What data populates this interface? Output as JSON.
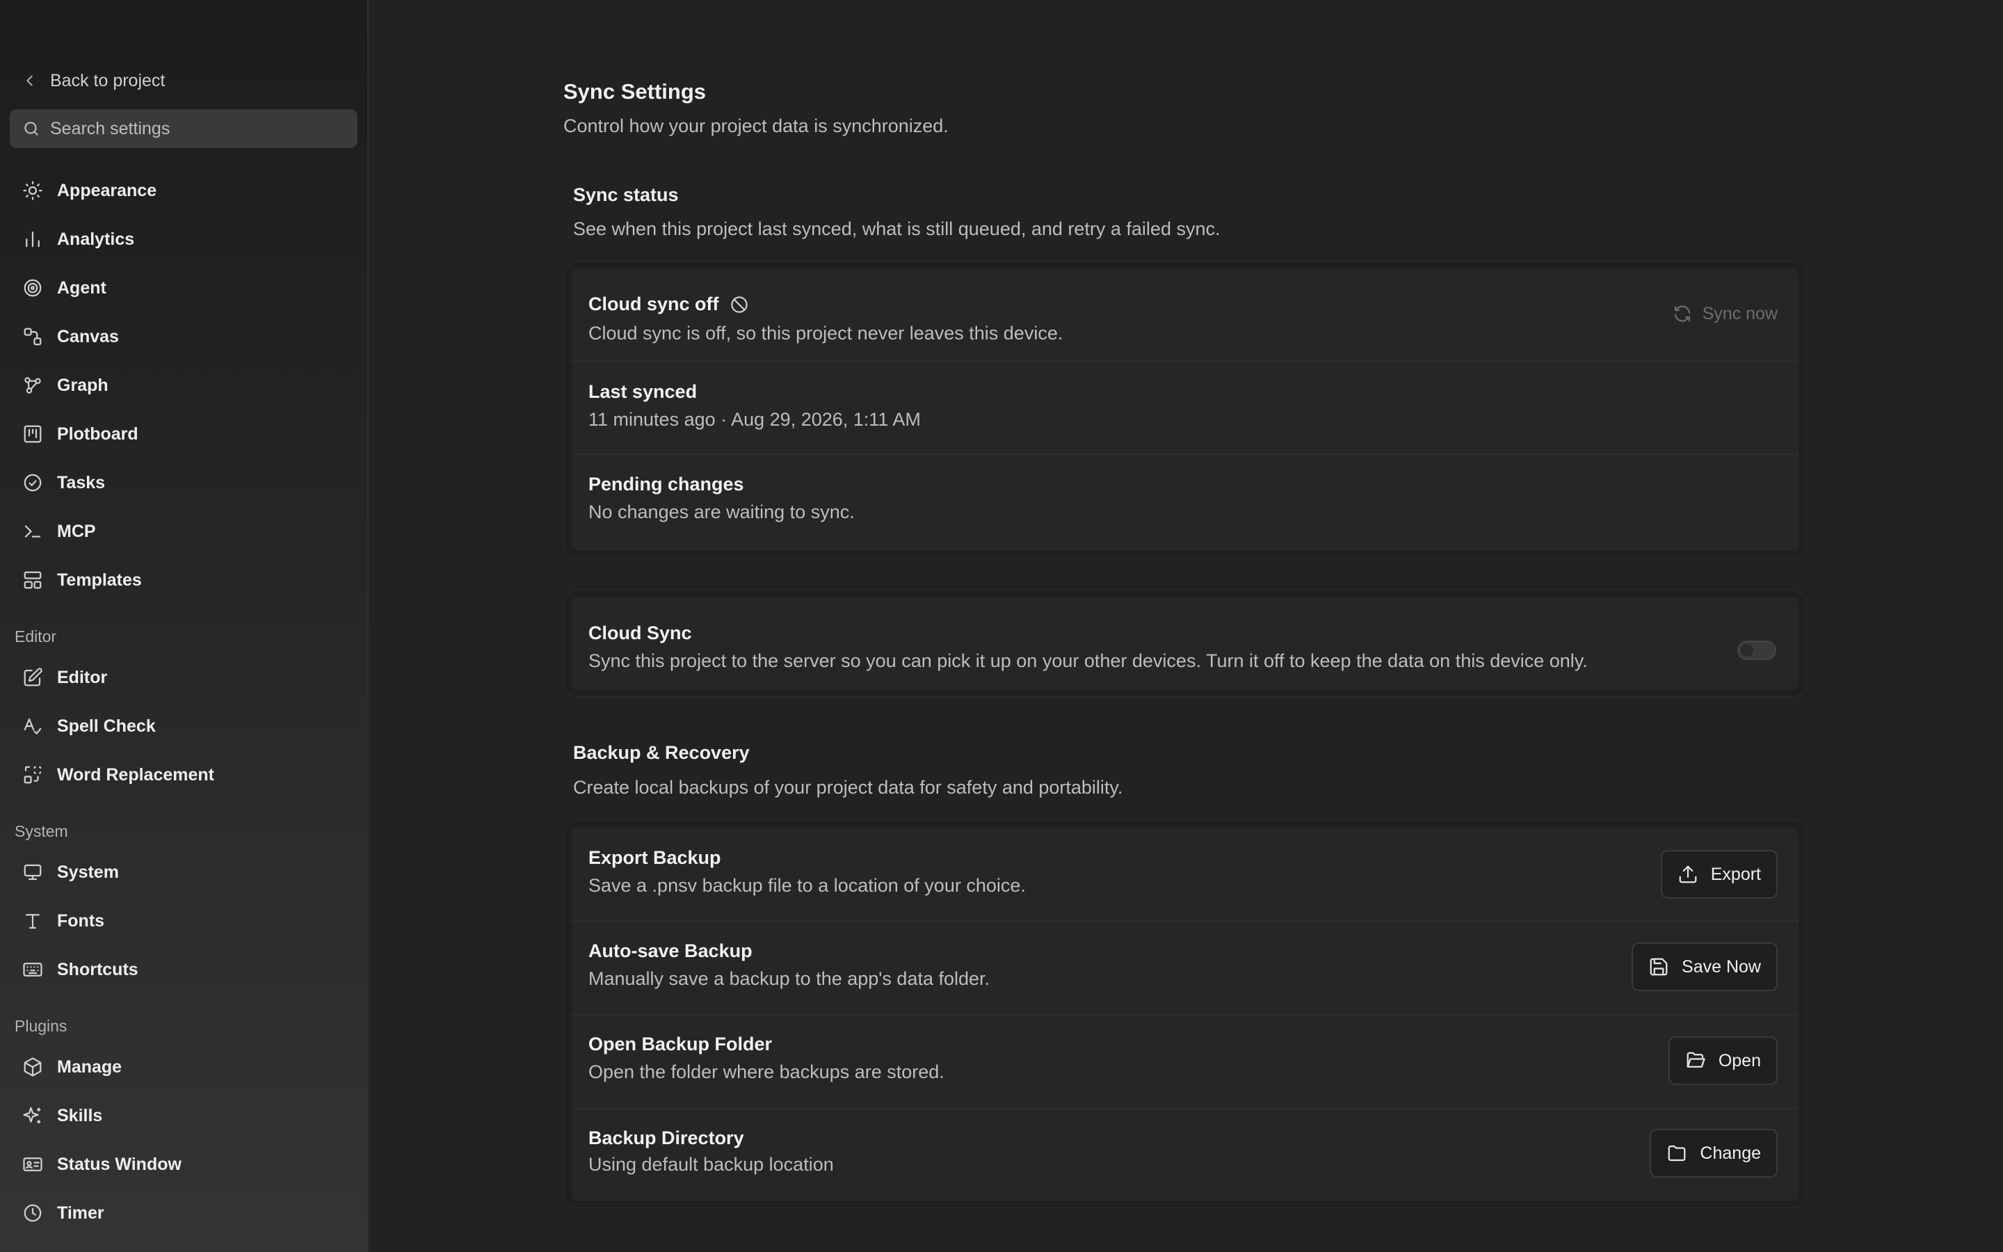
{
  "sidebar": {
    "back_label": "Back to project",
    "search_placeholder": "Search settings",
    "items": [
      {
        "label": "Appearance",
        "icon": "sun-icon"
      },
      {
        "label": "Analytics",
        "icon": "bar-chart-icon"
      },
      {
        "label": "Agent",
        "icon": "spiral-icon"
      },
      {
        "label": "Canvas",
        "icon": "canvas-icon"
      },
      {
        "label": "Graph",
        "icon": "graph-icon"
      },
      {
        "label": "Plotboard",
        "icon": "kanban-icon"
      },
      {
        "label": "Tasks",
        "icon": "check-circle-icon"
      },
      {
        "label": "MCP",
        "icon": "terminal-icon"
      },
      {
        "label": "Templates",
        "icon": "layout-icon"
      }
    ],
    "sections": {
      "editor": {
        "title": "Editor",
        "items": [
          {
            "label": "Editor",
            "icon": "pencil-square-icon"
          },
          {
            "label": "Spell Check",
            "icon": "spell-check-icon"
          },
          {
            "label": "Word Replacement",
            "icon": "replace-icon"
          }
        ]
      },
      "system": {
        "title": "System",
        "items": [
          {
            "label": "System",
            "icon": "monitor-icon"
          },
          {
            "label": "Fonts",
            "icon": "type-icon"
          },
          {
            "label": "Shortcuts",
            "icon": "keyboard-icon"
          }
        ]
      },
      "plugins": {
        "title": "Plugins",
        "items": [
          {
            "label": "Manage",
            "icon": "package-icon"
          },
          {
            "label": "Skills",
            "icon": "sparkles-icon"
          },
          {
            "label": "Status Window",
            "icon": "id-card-icon"
          },
          {
            "label": "Timer",
            "icon": "clock-icon"
          }
        ]
      }
    }
  },
  "main": {
    "title": "Sync Settings",
    "description": "Control how your project data is synchronized.",
    "sync_status": {
      "title": "Sync status",
      "description": "See when this project last synced, what is still queued, and retry a failed sync.",
      "cloud_off_title": "Cloud sync off",
      "cloud_off_desc": "Cloud sync is off, so this project never leaves this device.",
      "sync_now_label": "Sync now",
      "last_synced_title": "Last synced",
      "last_synced_value": "11 minutes ago · Aug 29, 2026, 1:11 AM",
      "pending_title": "Pending changes",
      "pending_value": "No changes are waiting to sync."
    },
    "cloud_sync": {
      "title": "Cloud Sync",
      "description": "Sync this project to the server so you can pick it up on your other devices. Turn it off to keep the data on this device only.",
      "enabled": false
    },
    "backup": {
      "title": "Backup & Recovery",
      "description": "Create local backups of your project data for safety and portability.",
      "export_title": "Export Backup",
      "export_desc": "Save a .pnsv backup file to a location of your choice.",
      "export_label": "Export",
      "autosave_title": "Auto-save Backup",
      "autosave_desc": "Manually save a backup to the app's data folder.",
      "autosave_label": "Save Now",
      "open_title": "Open Backup Folder",
      "open_desc": "Open the folder where backups are stored.",
      "open_label": "Open",
      "dir_title": "Backup Directory",
      "dir_desc": "Using default backup location",
      "dir_label": "Change"
    }
  }
}
